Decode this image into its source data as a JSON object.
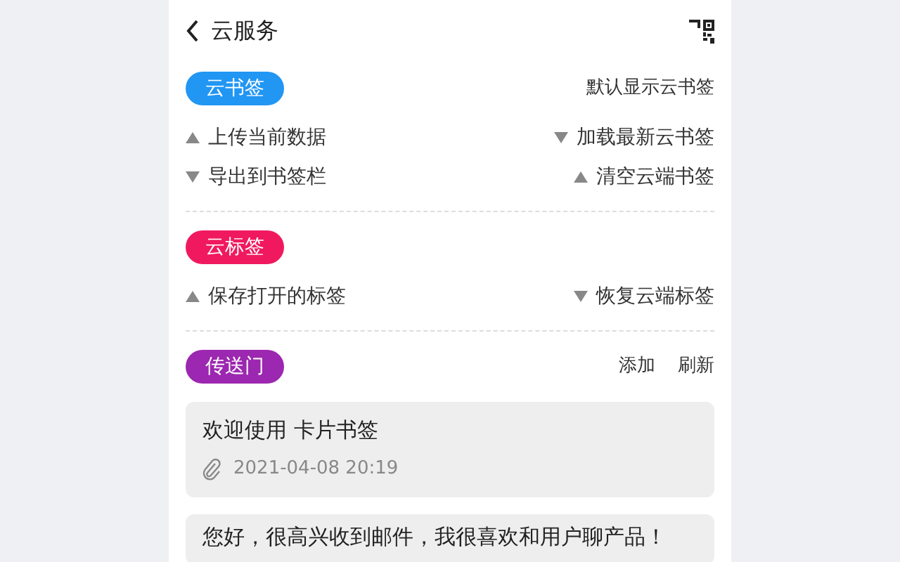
{
  "header": {
    "title": "云服务"
  },
  "sections": [
    {
      "label": "云书签",
      "color": "#2196f3",
      "links": [
        "默认显示云书签"
      ],
      "actions": [
        {
          "label": "上传当前数据",
          "kind": "up"
        },
        {
          "label": "加载最新云书签",
          "kind": "down"
        },
        {
          "label": "导出到书签栏",
          "kind": "down"
        },
        {
          "label": "清空云端书签",
          "kind": "up"
        }
      ]
    },
    {
      "label": "云标签",
      "color": "#f0195f",
      "actions": [
        {
          "label": "保存打开的标签",
          "kind": "up"
        },
        {
          "label": "恢复云端标签",
          "kind": "down"
        }
      ]
    },
    {
      "label": "传送门",
      "color": "#9c27b0",
      "links": [
        "添加",
        "刷新"
      ]
    }
  ],
  "cards": [
    {
      "text": "欢迎使用 卡片书签",
      "time": "2021-04-08 20:19"
    },
    {
      "text": "您好，很高兴收到邮件，我很喜欢和用户聊产品！"
    }
  ]
}
